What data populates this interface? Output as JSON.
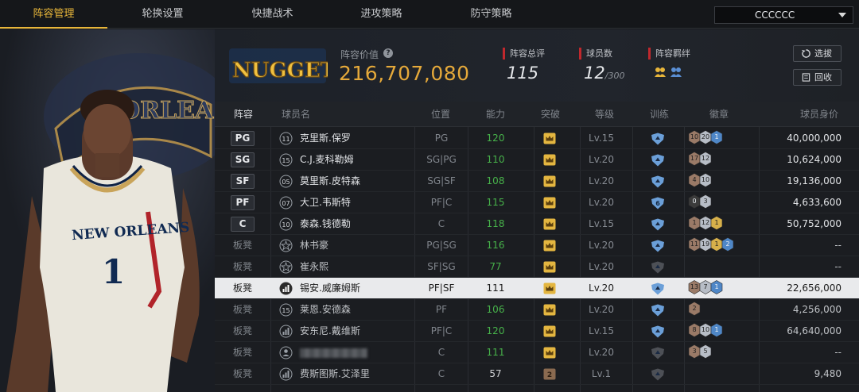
{
  "nav": {
    "tabs": [
      {
        "label": "阵容管理",
        "active": true
      },
      {
        "label": "轮换设置",
        "active": false
      },
      {
        "label": "快捷战术",
        "active": false
      },
      {
        "label": "进攻策略",
        "active": false
      },
      {
        "label": "防守策略",
        "active": false
      }
    ],
    "team_select": "CCCCCC"
  },
  "summary": {
    "logo_text": "NUGGETS",
    "value_label": "阵容价值",
    "value_amount": "216,707,080",
    "total_rating_label": "阵容总评",
    "total_rating": "115",
    "player_count_label": "球员数",
    "player_count": "12",
    "player_count_max": "/300",
    "bond_label": "阵容羁绊",
    "select_button": "选拔",
    "recycle_button": "回收"
  },
  "player_art": {
    "jersey_city": "NEW ORLEANS",
    "jersey_number": "1",
    "backdrop_text": "ORLEA"
  },
  "columns": [
    "阵容",
    "球员名",
    "位置",
    "能力",
    "突破",
    "等级",
    "训练",
    "徽章",
    "球员身价"
  ],
  "players": [
    {
      "slot": "PG",
      "starter": true,
      "num": "11",
      "name": "克里斯.保罗",
      "pos": "PG",
      "ovr": "120",
      "breakthrough": "gold",
      "level": "Lv.15",
      "training": "blue",
      "badges": [
        [
          "10",
          "bronze"
        ],
        [
          "20",
          "silver"
        ],
        [
          "1",
          "blue"
        ]
      ],
      "price": "40,000,000"
    },
    {
      "slot": "SG",
      "starter": true,
      "num": "15",
      "name": "C.J.麦科勒姆",
      "pos": "SG|PG",
      "ovr": "110",
      "breakthrough": "gold",
      "level": "Lv.20",
      "training": "blue",
      "badges": [
        [
          "17",
          "bronze"
        ],
        [
          "12",
          "silver"
        ]
      ],
      "price": "10,624,000"
    },
    {
      "slot": "SF",
      "starter": true,
      "num": "05",
      "name": "莫里斯.皮特森",
      "pos": "SG|SF",
      "ovr": "108",
      "breakthrough": "gold",
      "level": "Lv.20",
      "training": "blue",
      "badges": [
        [
          "4",
          "bronze"
        ],
        [
          "10",
          "silver"
        ]
      ],
      "price": "19,136,000"
    },
    {
      "slot": "PF",
      "starter": true,
      "num": "07",
      "name": "大卫.韦斯特",
      "pos": "PF|C",
      "ovr": "115",
      "breakthrough": "gold",
      "level": "Lv.20",
      "training": "blue6",
      "badges": [
        [
          "0",
          "dark"
        ],
        [
          "3",
          "silver"
        ]
      ],
      "price": "4,633,600"
    },
    {
      "slot": "C",
      "starter": true,
      "num": "10",
      "name": "泰森.钱德勒",
      "pos": "C",
      "ovr": "118",
      "breakthrough": "gold",
      "level": "Lv.15",
      "training": "blue",
      "badges": [
        [
          "1",
          "bronze"
        ],
        [
          "12",
          "silver"
        ],
        [
          "1",
          "gold"
        ]
      ],
      "price": "50,752,000"
    },
    {
      "slot": "板凳",
      "starter": false,
      "num": "star",
      "name": "林书豪",
      "pos": "PG|SG",
      "ovr": "116",
      "breakthrough": "gold",
      "level": "Lv.20",
      "training": "blue",
      "badges": [
        [
          "11",
          "bronze"
        ],
        [
          "19",
          "silver"
        ],
        [
          "1",
          "gold"
        ],
        [
          "2",
          "blue"
        ]
      ],
      "price": "--"
    },
    {
      "slot": "板凳",
      "starter": false,
      "num": "star",
      "name": "崔永熙",
      "pos": "SF|SG",
      "ovr": "77",
      "breakthrough": "gold",
      "level": "Lv.20",
      "training": "grey",
      "badges": [],
      "price": "--"
    },
    {
      "slot": "板凳",
      "starter": false,
      "num": "bars",
      "name": "锡安.威廉姆斯",
      "pos": "PF|SF",
      "ovr": "111",
      "breakthrough": "gold",
      "level": "Lv.20",
      "training": "blue",
      "badges": [
        [
          "13",
          "bronze"
        ],
        [
          "7",
          "silver"
        ],
        [
          "1",
          "blue"
        ]
      ],
      "price": "22,656,000",
      "selected": true
    },
    {
      "slot": "板凳",
      "starter": false,
      "num": "15",
      "name": "莱恩.安德森",
      "pos": "PF",
      "ovr": "106",
      "breakthrough": "gold",
      "level": "Lv.20",
      "training": "blue",
      "badges": [
        [
          "2",
          "bronze"
        ]
      ],
      "price": "4,256,000"
    },
    {
      "slot": "板凳",
      "starter": false,
      "num": "bars",
      "name": "安东尼.戴维斯",
      "pos": "PF|C",
      "ovr": "120",
      "breakthrough": "gold",
      "level": "Lv.15",
      "training": "blue",
      "badges": [
        [
          "8",
          "bronze"
        ],
        [
          "10",
          "silver"
        ],
        [
          "1",
          "blue"
        ]
      ],
      "price": "64,640,000"
    },
    {
      "slot": "板凳",
      "starter": false,
      "num": "person",
      "name": "",
      "blurred": true,
      "pos": "C",
      "ovr": "111",
      "breakthrough": "gold",
      "level": "Lv.20",
      "training": "grey",
      "badges": [
        [
          "3",
          "bronze"
        ],
        [
          "5",
          "silver"
        ]
      ],
      "price": "--"
    },
    {
      "slot": "板凳",
      "starter": false,
      "num": "bars",
      "name": "费斯图斯.艾泽里",
      "pos": "C",
      "ovr": "57",
      "breakthrough": "bronze2",
      "level": "Lv.1",
      "training": "grey",
      "badges": [],
      "price": "9,480"
    }
  ],
  "colors": {
    "accent": "#e8b63a",
    "value": "#e5a93a",
    "rating_green": "#47b24a",
    "stat_marker": "#c0282d",
    "badge_blue": "#4f87c7"
  },
  "icons": [
    "help-icon",
    "bond-icon",
    "refresh-icon",
    "recycle-icon",
    "crown-icon",
    "shield-icon",
    "star-icon",
    "bars-icon",
    "person-icon",
    "chevron-down-icon"
  ]
}
